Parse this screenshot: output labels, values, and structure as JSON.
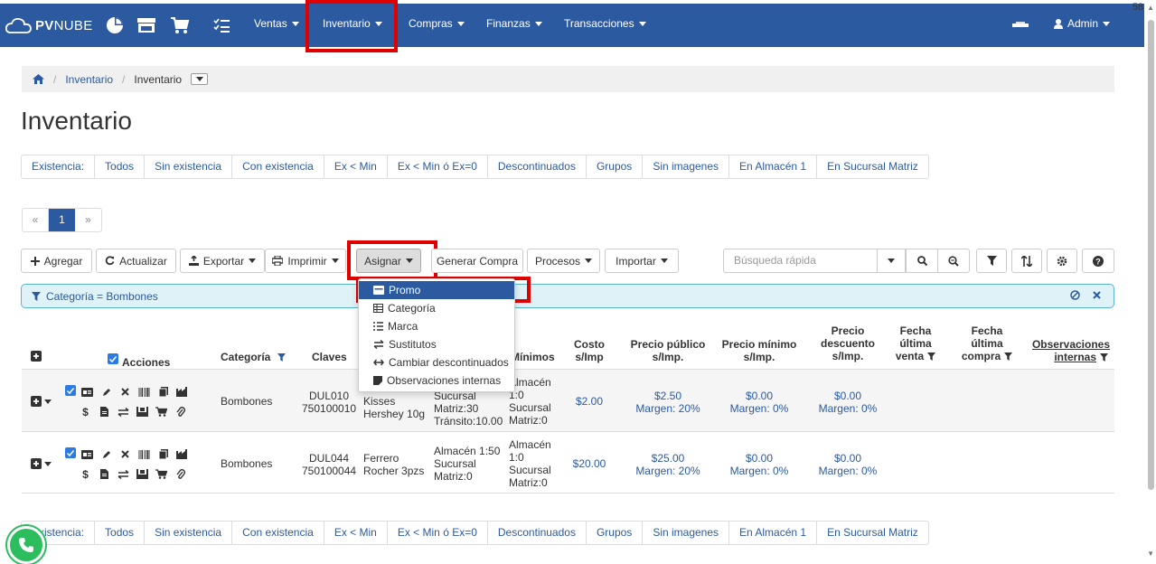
{
  "topnav": {
    "brand_bold": "PV",
    "brand_light": "NUBE",
    "menus": [
      {
        "label": "Ventas"
      },
      {
        "label": "Inventario"
      },
      {
        "label": "Compras"
      },
      {
        "label": "Finanzas"
      },
      {
        "label": "Transacciones"
      }
    ],
    "user_label": "Admin",
    "corner_number": "58"
  },
  "breadcrumb": {
    "items": [
      "Inventario",
      "Inventario"
    ]
  },
  "page_title": "Inventario",
  "filters": [
    "Existencia:",
    "Todos",
    "Sin existencia",
    "Con existencia",
    "Ex < Min",
    "Ex < Min ó Ex=0",
    "Descontinuados",
    "Grupos",
    "Sin imagenes",
    "En Almacén 1",
    "En Sucursal Matriz"
  ],
  "pager": {
    "prev": "«",
    "current": "1",
    "next": "»"
  },
  "toolbar": {
    "agregar": "Agregar",
    "actualizar": "Actualizar",
    "exportar": "Exportar",
    "imprimir": "Imprimir",
    "asignar": "Asignar",
    "generar_compra": "Generar Compra",
    "procesos": "Procesos",
    "importar": "Importar",
    "search_placeholder": "Búsqueda rápida"
  },
  "active_filter": "Categoría = Bombones",
  "asignar_menu": [
    {
      "label": "Promo",
      "icon": "tag-icon"
    },
    {
      "label": "Categoría",
      "icon": "table-icon"
    },
    {
      "label": "Marca",
      "icon": "list-icon"
    },
    {
      "label": "Sustitutos",
      "icon": "swap-icon"
    },
    {
      "label": "Cambiar descontinuados",
      "icon": "arrows-icon"
    },
    {
      "label": "Observaciones internas",
      "icon": "note-icon"
    }
  ],
  "table": {
    "headers": {
      "acciones": "Acciones",
      "categoria": "Categoría",
      "claves": "Claves",
      "minimos": "Mínimos",
      "costo": [
        "Costo",
        "s/Imp"
      ],
      "precio_publico": [
        "Precio público",
        "s/Imp."
      ],
      "precio_minimo": [
        "Precio mínimo",
        "s/Imp."
      ],
      "precio_descuento": [
        "Precio",
        "descuento",
        "s/Imp."
      ],
      "fecha_venta": [
        "Fecha",
        "última",
        "venta"
      ],
      "fecha_compra": [
        "Fecha",
        "última",
        "compra"
      ],
      "observaciones": [
        "Observaciones",
        "internas"
      ]
    },
    "rows": [
      {
        "categoria": "Bombones",
        "clave1": "DUL010",
        "clave2": "750100010",
        "desc1": "Kisses",
        "desc2": "Hershey 10g",
        "exist1": "Sucursal",
        "exist2": "Matriz:30",
        "exist3": "Tránsito:10.00",
        "min1": "Almacén",
        "min2": "1:0",
        "min3": "Sucursal",
        "min4": "Matriz:0",
        "costo": "$2.00",
        "pp": "$2.50",
        "pp_m": "Margen: 20%",
        "pm": "$0.00",
        "pm_m": "Margen: 0%",
        "pd": "$0.00",
        "pd_m": "Margen: 0%"
      },
      {
        "categoria": "Bombones",
        "clave1": "DUL044",
        "clave2": "750100044",
        "desc1": "Ferrero",
        "desc2": "Rocher 3pzs",
        "exist1": "Almacén 1:50",
        "exist2": "Sucursal",
        "exist3": "Matriz:0",
        "min1": "Almacén",
        "min2": "1:0",
        "min3": "Sucursal",
        "min4": "Matriz:0",
        "costo": "$20.00",
        "pp": "$25.00",
        "pp_m": "Margen: 20%",
        "pm": "$0.00",
        "pm_m": "Margen: 0%",
        "pd": "$0.00",
        "pd_m": "Margen: 0%"
      }
    ]
  },
  "colors": {
    "nav": "#2c5aa0",
    "highlight": "#e00000",
    "whatsapp": "#2bbd5e"
  }
}
